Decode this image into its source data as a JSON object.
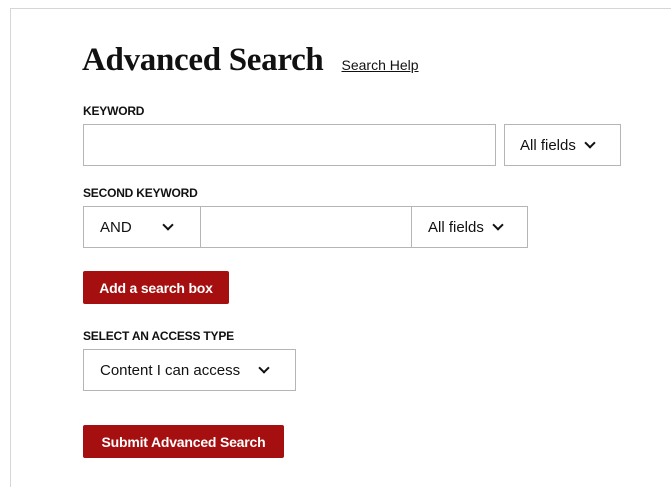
{
  "header": {
    "title": "Advanced Search",
    "help_link": "Search Help"
  },
  "keyword": {
    "label": "KEYWORD",
    "value": "",
    "field_select": "All fields"
  },
  "second_keyword": {
    "label": "SECOND KEYWORD",
    "operator": "AND",
    "value": "",
    "field_select": "All fields"
  },
  "add_box_button": "Add a search box",
  "access": {
    "label": "SELECT AN ACCESS TYPE",
    "selected": "Content I can access"
  },
  "submit_button": "Submit Advanced Search",
  "colors": {
    "accent": "#a50f0f",
    "border": "#b5b5b5"
  },
  "icons": {
    "dropdown": "chevron-down-icon"
  }
}
